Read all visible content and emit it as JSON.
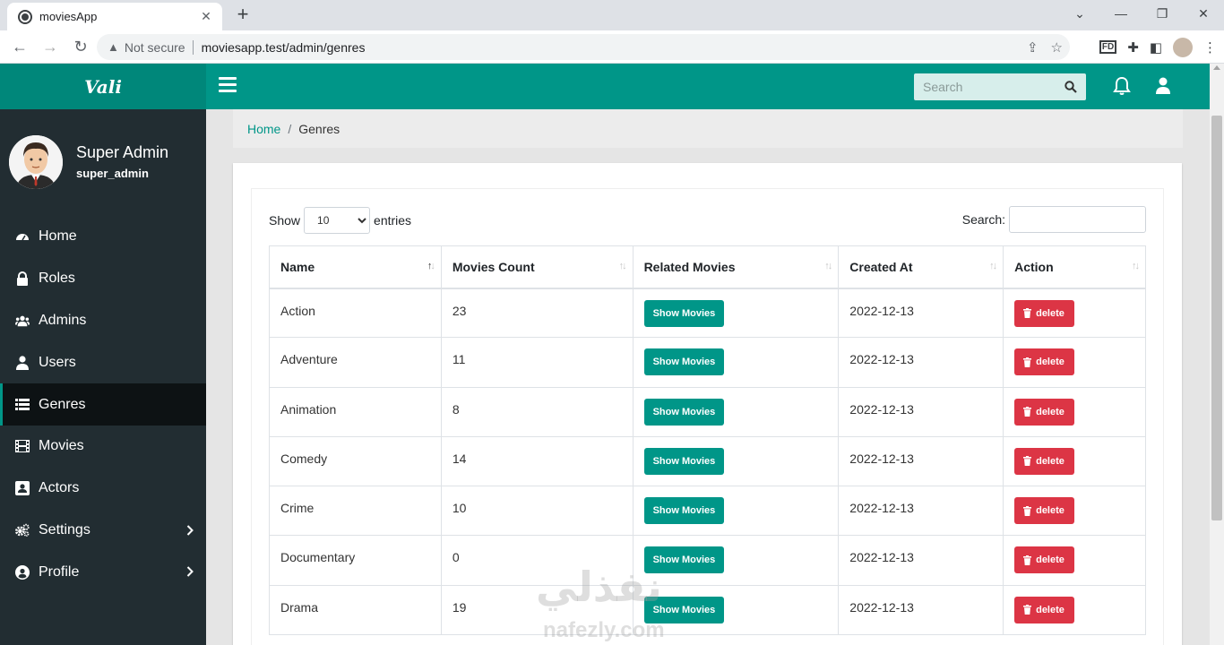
{
  "browser": {
    "tab_title": "moviesApp",
    "security_label": "Not secure",
    "url": "moviesapp.test/admin/genres",
    "ext_fd_label": "FD"
  },
  "header": {
    "logo": "Vali",
    "search_placeholder": "Search"
  },
  "sidebar": {
    "user_name": "Super Admin",
    "user_role": "super_admin",
    "items": [
      {
        "label": "Home",
        "icon": "dashboard-icon"
      },
      {
        "label": "Roles",
        "icon": "lock-icon"
      },
      {
        "label": "Admins",
        "icon": "users-icon"
      },
      {
        "label": "Users",
        "icon": "user-icon"
      },
      {
        "label": "Genres",
        "icon": "list-icon"
      },
      {
        "label": "Movies",
        "icon": "film-icon"
      },
      {
        "label": "Actors",
        "icon": "portrait-icon"
      },
      {
        "label": "Settings",
        "icon": "cogs-icon"
      },
      {
        "label": "Profile",
        "icon": "user-circle-icon"
      }
    ]
  },
  "breadcrumb": {
    "home": "Home",
    "separator": "/",
    "current": "Genres"
  },
  "table_controls": {
    "show_label": "Show",
    "entries_label": "entries",
    "page_length": "10",
    "search_label": "Search:"
  },
  "table": {
    "columns": [
      "Name",
      "Movies Count",
      "Related Movies",
      "Created At",
      "Action"
    ],
    "show_button": "Show Movies",
    "delete_button": "delete",
    "rows": [
      {
        "name": "Action",
        "count": "23",
        "created": "2022-12-13"
      },
      {
        "name": "Adventure",
        "count": "11",
        "created": "2022-12-13"
      },
      {
        "name": "Animation",
        "count": "8",
        "created": "2022-12-13"
      },
      {
        "name": "Comedy",
        "count": "14",
        "created": "2022-12-13"
      },
      {
        "name": "Crime",
        "count": "10",
        "created": "2022-12-13"
      },
      {
        "name": "Documentary",
        "count": "0",
        "created": "2022-12-13"
      },
      {
        "name": "Drama",
        "count": "19",
        "created": "2022-12-13"
      }
    ]
  },
  "watermark": {
    "arabic": "نفذلي",
    "latin": "nafezly.com"
  },
  "colors": {
    "primary": "#009688",
    "sidebar": "#222d32",
    "danger": "#dc3545"
  }
}
